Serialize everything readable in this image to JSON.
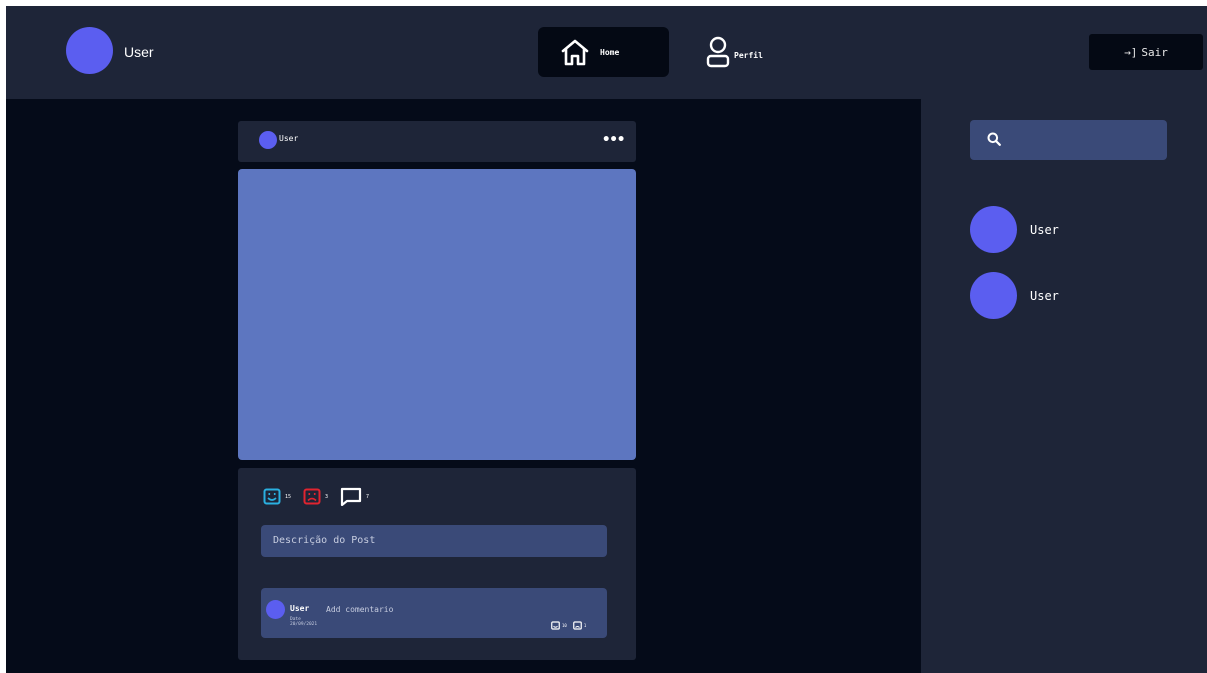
{
  "header": {
    "username": "User",
    "nav": {
      "home_label": "Home",
      "perfil_label": "Perfil"
    },
    "logout_label": "Sair"
  },
  "post": {
    "username": "User",
    "reactions": {
      "likes": "15",
      "dislikes": "3",
      "comments": "7"
    },
    "description": "Descrição do Post",
    "comment": {
      "username": "User",
      "placeholder": "Add comentario",
      "date_label": "Date",
      "date": "20/09/2021",
      "likes": "10",
      "dislikes": "1"
    }
  },
  "sidebar": {
    "users": [
      {
        "name": "User"
      },
      {
        "name": "User"
      }
    ]
  },
  "colors": {
    "background": "#050b19",
    "panel": "#1e2538",
    "accent_avatar": "#5b5ef0",
    "image_placeholder": "#5d76c0",
    "input": "#3a4a78",
    "like": "#2ab0e0",
    "dislike": "#e0242f"
  },
  "icons": [
    "home-icon",
    "user-icon",
    "logout-arrow-icon",
    "more-dots-icon",
    "search-icon",
    "smile-icon",
    "sad-icon",
    "comment-icon"
  ]
}
